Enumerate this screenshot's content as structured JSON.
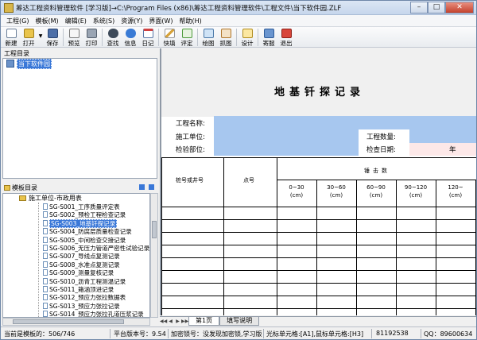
{
  "window": {
    "title": "筹达工程资料管理软件 [学习版]→C:\\Program Files (x86)\\筹达工程资料管理软件\\工程文件\\当下软件园.ZLF",
    "min_label": "–",
    "max_label": "□",
    "close_label": "✕"
  },
  "menu": [
    "工程(G)",
    "模板(M)",
    "编辑(E)",
    "系统(S)",
    "资源(Y)",
    "界面(W)",
    "帮助(H)"
  ],
  "toolbar": {
    "new": "新建",
    "open": "打开",
    "save": "保存",
    "preview": "预览",
    "print": "打印",
    "find": "查找",
    "info": "信息",
    "diary": "日记",
    "quick": "快填",
    "review": "评定",
    "drawing": "绘图",
    "capture": "抓图",
    "design": "设计",
    "host": "寄服",
    "exit": "退出",
    "dropdown_arrow": "▼"
  },
  "project_pane": {
    "header": "工程目录",
    "root": "当下软件园"
  },
  "template_pane": {
    "header": "模板目录",
    "folder": "施工单位-市政用表",
    "items": [
      "SG-S001_工序质量评定表",
      "SG-S002_预检工程检查记录",
      "SG-S003_地基钎探记录",
      "SG-S004_防腐层质量检查记录",
      "SG-S005_中间检查交接记录",
      "SG-S006_无压力管道严密性试验记录",
      "SG-S007_导线点复测记录",
      "SG-S008_水准点复测记录",
      "SG-S009_测量复核记录",
      "SG-S010_沥青工程测温记录",
      "SG-S011_箱涵顶进记录",
      "SG-S012_预应力张拉数据表",
      "SG-S013_预应力张拉记录",
      "SG-S014_预应力张拉孔道压浆记录"
    ],
    "selected_index": 2
  },
  "sheet": {
    "title": "地基钎探记录",
    "fields": {
      "project_name": "工程名称:",
      "contractor": "施工单位:",
      "quantity": "工程数量:",
      "inspect_part": "检验部位:",
      "inspect_date": "检查日期:",
      "year": "年"
    },
    "table": {
      "col_pile": "桩号或井号",
      "col_point": "点号",
      "col_blows": "锤击数",
      "depth_cols": [
        "0~30",
        "30~60",
        "60~90",
        "90~120",
        "120~"
      ],
      "unit": "(cm)"
    }
  },
  "tabs": {
    "nav": [
      "◀◀",
      "◀",
      "▶",
      "▶▶"
    ],
    "sheet1": "第1页",
    "sheet2": "填写说明"
  },
  "status": {
    "count": "当前是模板的：506/746",
    "version": "平台版本号：9.54",
    "lock": "加密锁号：没发现加密锁,学习版",
    "cell": "光标单元格:[A1],鼠标单元格:[H3]",
    "phone": "81192538",
    "qq": "QQ：89600634"
  },
  "colors": {
    "accent_blue": "#a7c7ef",
    "date_pink": "#fde8e8",
    "selection": "#3a78d8"
  }
}
